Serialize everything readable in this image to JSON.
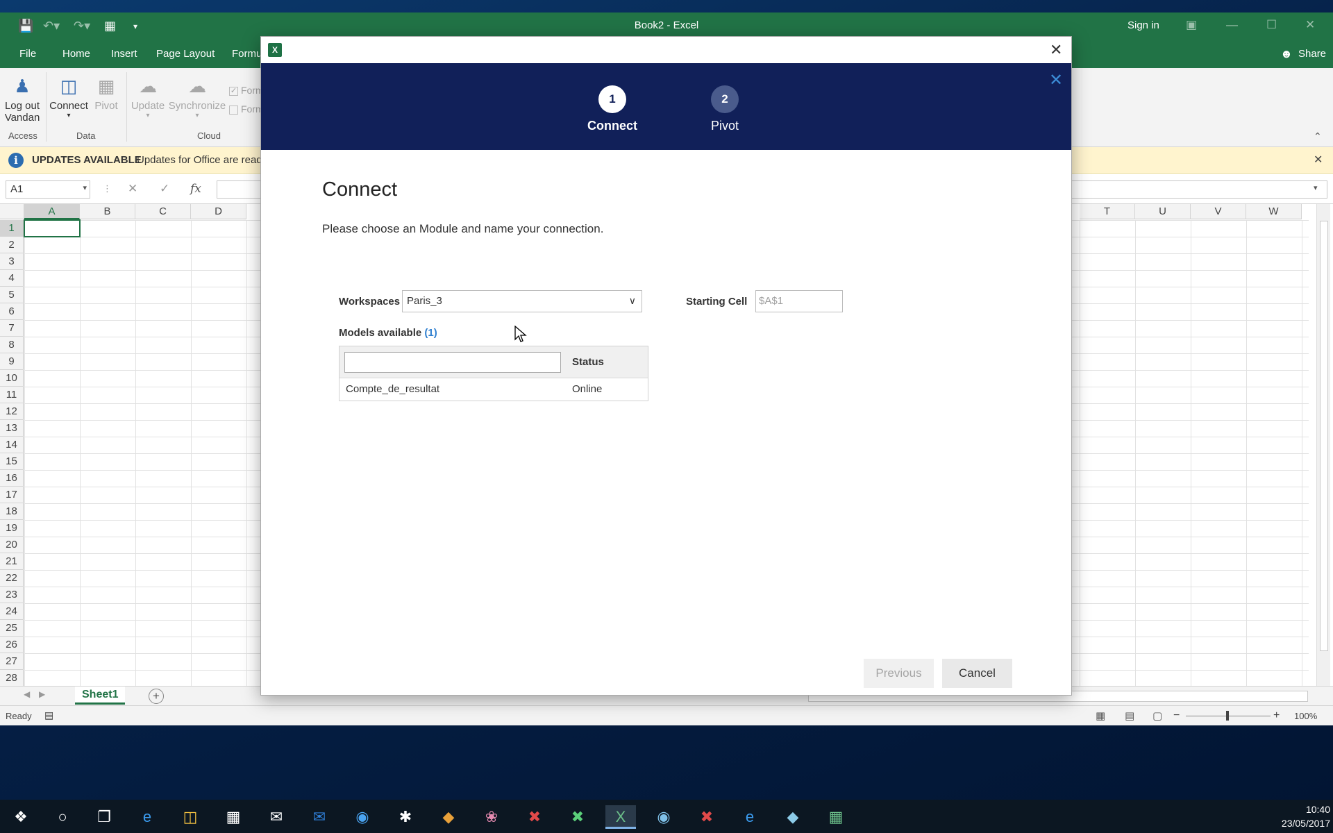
{
  "window": {
    "title": "Book2  -  Excel",
    "signin": "Sign in"
  },
  "ribbon_tabs": [
    "File",
    "Home",
    "Insert",
    "Page Layout",
    "Formu"
  ],
  "share": "Share",
  "ribbon": {
    "logout_line1": "Log out",
    "logout_line2": "Vandan",
    "connect": "Connect",
    "pivot": "Pivot",
    "update": "Update",
    "synchronize": "Synchronize",
    "group_access": "Access",
    "group_data": "Data",
    "group_cloud": "Cloud",
    "check1": "Form",
    "check2": "Form"
  },
  "updates": {
    "title": "UPDATES AVAILABLE",
    "message": "Updates for Office are read"
  },
  "formula_bar": {
    "name_box": "A1",
    "fx": "fx"
  },
  "grid": {
    "columns_left": [
      "A",
      "B",
      "C",
      "D"
    ],
    "columns_right": [
      "T",
      "U",
      "V",
      "W"
    ],
    "rows": [
      "1",
      "2",
      "3",
      "4",
      "5",
      "6",
      "7",
      "8",
      "9",
      "10",
      "11",
      "12",
      "13",
      "14",
      "15",
      "16",
      "17",
      "18",
      "19",
      "20",
      "21",
      "22",
      "23",
      "24",
      "25",
      "26",
      "27",
      "28"
    ]
  },
  "sheet_tab": "Sheet1",
  "status": {
    "ready": "Ready",
    "zoom": "100%"
  },
  "dialog": {
    "steps": [
      {
        "number": "1",
        "label": "Connect"
      },
      {
        "number": "2",
        "label": "Pivot"
      }
    ],
    "heading": "Connect",
    "subtitle": "Please choose an Module and name your connection.",
    "workspaces_label": "Workspaces",
    "workspace_value": "Paris_3",
    "starting_cell_label": "Starting Cell",
    "starting_cell_placeholder": "$A$1",
    "models_label": "Models available",
    "models_count": "(1)",
    "status_header": "Status",
    "models": [
      {
        "name": "Compte_de_resultat",
        "status": "Online"
      }
    ],
    "previous": "Previous",
    "cancel": "Cancel"
  },
  "taskbar": {
    "time": "10:40",
    "date": "23/05/2017"
  }
}
